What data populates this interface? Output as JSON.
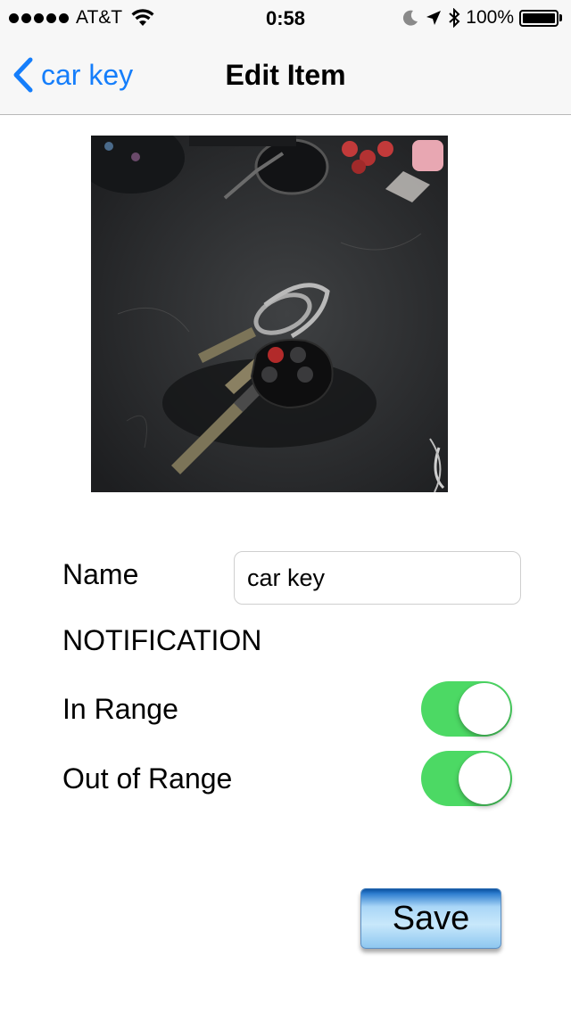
{
  "status_bar": {
    "carrier": "AT&T",
    "time": "0:58",
    "battery": "100%",
    "signal_icon": "signal-dots-icon",
    "wifi_icon": "wifi-icon",
    "moon_icon": "moon-icon",
    "location_icon": "location-arrow-icon",
    "bluetooth_icon": "bluetooth-icon",
    "battery_icon": "battery-icon"
  },
  "nav": {
    "back_label": "car key",
    "title": "Edit Item",
    "back_icon": "chevron-left-icon"
  },
  "photo": {
    "subject": "car-keys-photo"
  },
  "form": {
    "name_label": "Name",
    "name_value": "car key",
    "notification_heading": "NOTIFICATION",
    "in_range_label": "In Range",
    "out_of_range_label": "Out of Range",
    "in_range_on": true,
    "out_of_range_on": true
  },
  "save_label": "Save",
  "colors": {
    "accent": "#157efb",
    "toggle_on": "#4cd964"
  }
}
